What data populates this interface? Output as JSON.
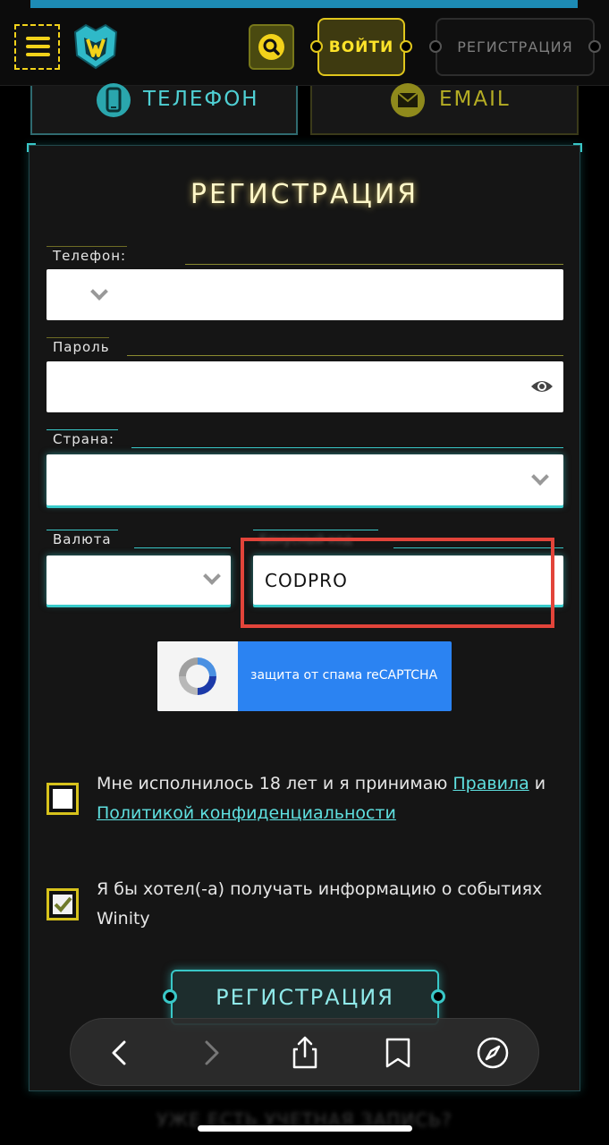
{
  "header": {
    "login_label": "ВОЙТИ",
    "register_label": "РЕГИСТРАЦИЯ",
    "icons": [
      "menu-icon",
      "logo-icon",
      "search-icon"
    ]
  },
  "tabs": [
    {
      "label": "ТЕЛЕФОН",
      "icon": "phone-icon",
      "active": true
    },
    {
      "label": "EMAIL",
      "icon": "envelope-icon",
      "active": false
    }
  ],
  "form": {
    "title": "РЕГИСТРАЦИЯ",
    "phone_label": "Телефон:",
    "phone_value": "",
    "password_label": "Пароль",
    "password_value": "",
    "country_label": "Страна:",
    "country_value": "",
    "currency_label": "Валюта",
    "currency_value": "",
    "promo_label": "Бонусный код",
    "promo_value": "CODPRO",
    "captcha_text": "защита от спама reCAPTCHA",
    "age_text_before": "Мне исполнилось 18 лет и я принимаю ",
    "age_link_rules": "Правила",
    "age_text_and": " и",
    "age_link_privacy": "Политикой конфиденциальности",
    "age_checked": false,
    "news_text": "Я бы хотел(-а) получать информацию о событиях Winity",
    "news_checked": true,
    "submit_label": "РЕГИСТРАЦИЯ"
  },
  "footer": {
    "have_account_text": "УЖЕ ЕСТЬ УЧЕТНАЯ ЗАПИСЬ?"
  },
  "browser_bar": {
    "icons": [
      "back-icon",
      "forward-icon",
      "share-icon",
      "bookmarks-icon",
      "compass-icon"
    ]
  },
  "colors": {
    "accent_yellow": "#f2d21a",
    "accent_cyan": "#39c7c7",
    "highlight_red": "#e2443a",
    "captcha_blue": "#2b83f2"
  }
}
